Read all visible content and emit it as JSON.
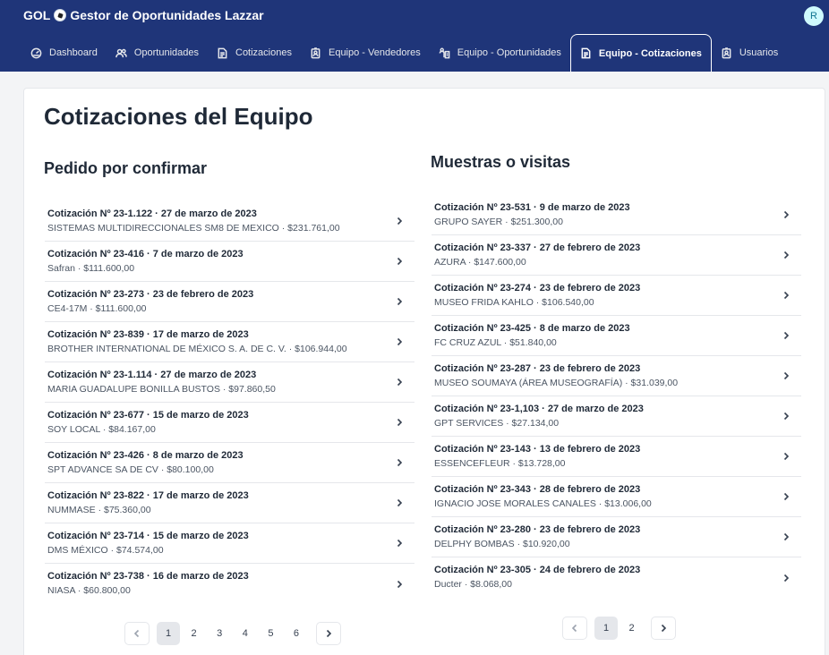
{
  "header": {
    "brand_prefix": "GOL",
    "brand_title": "Gestor de Oportunidades Lazzar",
    "avatar_initial": "R"
  },
  "nav": [
    {
      "label": "Dashboard",
      "icon": "dashboard-icon"
    },
    {
      "label": "Oportunidades",
      "icon": "users-icon"
    },
    {
      "label": "Cotizaciones",
      "icon": "document-icon"
    },
    {
      "label": "Equipo - Vendedores",
      "icon": "badge-icon"
    },
    {
      "label": "Equipo - Oportunidades",
      "icon": "team-icon"
    },
    {
      "label": "Equipo - Cotizaciones",
      "icon": "document-icon",
      "active": true
    },
    {
      "label": "Usuarios",
      "icon": "badge-icon"
    }
  ],
  "page": {
    "title": "Cotizaciones del Equipo"
  },
  "left": {
    "title": "Pedido por confirmar",
    "items": [
      {
        "title": "Cotización Nº 23-1.122 · 27 de marzo de 2023",
        "subtitle": "SISTEMAS MULTIDIRECCIONALES SM8 DE MEXICO · $231.761,00"
      },
      {
        "title": "Cotización Nº 23-416 · 7 de marzo de 2023",
        "subtitle": "Safran · $111.600,00"
      },
      {
        "title": "Cotización Nº 23-273 · 23 de febrero de 2023",
        "subtitle": "CE4-17M · $111.600,00"
      },
      {
        "title": "Cotización Nº 23-839 · 17 de marzo de 2023",
        "subtitle": "BROTHER INTERNATIONAL DE MÉXICO S. A. DE C. V. · $106.944,00"
      },
      {
        "title": "Cotización Nº 23-1.114 · 27 de marzo de 2023",
        "subtitle": "MARIA GUADALUPE BONILLA BUSTOS · $97.860,50"
      },
      {
        "title": "Cotización Nº 23-677 · 15 de marzo de 2023",
        "subtitle": "SOY LOCAL · $84.167,00"
      },
      {
        "title": "Cotización Nº 23-426 · 8 de marzo de 2023",
        "subtitle": "SPT ADVANCE SA DE CV · $80.100,00"
      },
      {
        "title": "Cotización Nº 23-822 · 17 de marzo de 2023",
        "subtitle": "NUMMASE · $75.360,00"
      },
      {
        "title": "Cotización Nº 23-714 · 15 de marzo de 2023",
        "subtitle": "DMS MÉXICO · $74.574,00"
      },
      {
        "title": "Cotización Nº 23-738 · 16 de marzo de 2023",
        "subtitle": "NIASA · $60.800,00"
      }
    ],
    "pagination": {
      "pages": [
        "1",
        "2",
        "3",
        "4",
        "5",
        "6"
      ],
      "current": "1"
    }
  },
  "right": {
    "title": "Muestras o visitas",
    "items": [
      {
        "title": "Cotización Nº 23-531 · 9 de marzo de 2023",
        "subtitle": "GRUPO SAYER · $251.300,00"
      },
      {
        "title": "Cotización Nº 23-337 · 27 de febrero de 2023",
        "subtitle": "AZURA · $147.600,00"
      },
      {
        "title": "Cotización Nº 23-274 · 23 de febrero de 2023",
        "subtitle": "MUSEO FRIDA KAHLO · $106.540,00"
      },
      {
        "title": "Cotización Nº 23-425 · 8 de marzo de 2023",
        "subtitle": "FC CRUZ AZUL · $51.840,00"
      },
      {
        "title": "Cotización Nº 23-287 · 23 de febrero de 2023",
        "subtitle": "MUSEO SOUMAYA (ÁREA MUSEOGRAFÍA) · $31.039,00"
      },
      {
        "title": "Cotización Nº 23-1,103 · 27 de marzo de 2023",
        "subtitle": "GPT SERVICES · $27.134,00"
      },
      {
        "title": "Cotización Nº 23-143 · 13 de febrero de 2023",
        "subtitle": "ESSENCEFLEUR · $13.728,00"
      },
      {
        "title": "Cotización Nº 23-343 · 28 de febrero de 2023",
        "subtitle": "IGNACIO JOSE MORALES CANALES · $13.006,00"
      },
      {
        "title": "Cotización Nº 23-280 · 23 de febrero de 2023",
        "subtitle": "DELPHY BOMBAS · $10.920,00"
      },
      {
        "title": "Cotización Nº 23-305 · 24 de febrero de 2023",
        "subtitle": "Ducter · $8.068,00"
      }
    ],
    "pagination": {
      "pages": [
        "1",
        "2"
      ],
      "current": "1"
    }
  },
  "colors": {
    "header_bg": "#1f3579",
    "page_bg": "#f3f4f6",
    "card_bg": "#ffffff"
  }
}
